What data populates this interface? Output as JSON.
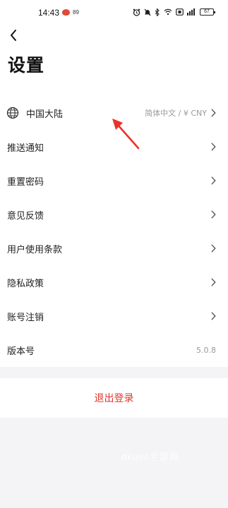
{
  "status_bar": {
    "time": "14:43",
    "small_text": "89",
    "battery": "67"
  },
  "header": {
    "title": "设置"
  },
  "settings": {
    "region": {
      "label": "中国大陆",
      "value": "简体中文 / ¥ CNY"
    },
    "items": [
      {
        "label": "推送通知"
      },
      {
        "label": "重置密码"
      },
      {
        "label": "意见反馈"
      },
      {
        "label": "用户使用条款"
      },
      {
        "label": "隐私政策"
      },
      {
        "label": "账号注销"
      }
    ],
    "version": {
      "label": "版本号",
      "value": "5.0.8"
    }
  },
  "logout": {
    "label": "退出登录"
  },
  "watermark": "dkuec手游网",
  "colors": {
    "accent_red": "#e0362e",
    "background": "#f4f4f6",
    "card": "#ffffff",
    "annotation_arrow": "#e8332a"
  },
  "icons": {
    "back": "chevron-left-icon",
    "region": "globe-icon",
    "row_arrow": "chevron-right-icon"
  }
}
